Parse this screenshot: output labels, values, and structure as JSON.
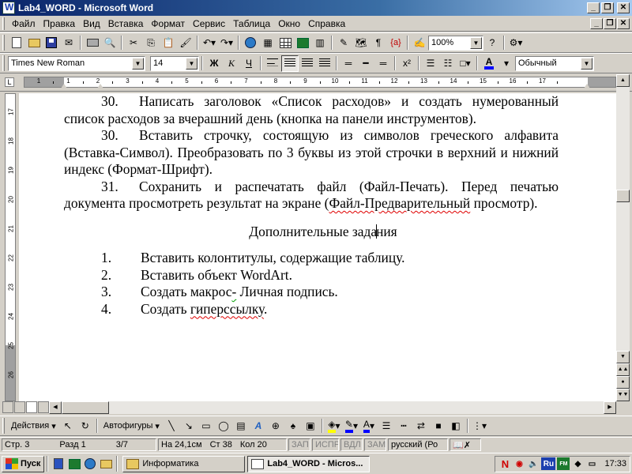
{
  "window": {
    "title": "Lab4_WORD - Microsoft Word"
  },
  "menu": [
    "Файл",
    "Правка",
    "Вид",
    "Вставка",
    "Формат",
    "Сервис",
    "Таблица",
    "Окно",
    "Справка"
  ],
  "standard_toolbar": {
    "zoom": "100%"
  },
  "formatting_toolbar": {
    "font": "Times New Roman",
    "size": "14",
    "bold": "Ж",
    "italic": "К",
    "underline": "Ч",
    "style": "Обычный",
    "superscript": "x²",
    "font_color": "A"
  },
  "ruler": {
    "h_numbers": [
      "1",
      "1",
      "2",
      "3",
      "4",
      "5",
      "6",
      "7",
      "8",
      "9",
      "10",
      "11",
      "12",
      "13",
      "14",
      "15",
      "16",
      "17"
    ],
    "v_numbers": [
      "17",
      "18",
      "19",
      "20",
      "21",
      "22",
      "23",
      "24",
      "25",
      "26",
      "27"
    ]
  },
  "document": {
    "p30a_num": "30.",
    "p30a_text": "Написать заголовок «Список расходов» и создать нумерованный список расходов за вчерашний день (кнопка на панели инструментов).",
    "p30b_num": "30.",
    "p30b_text": "Вставить строчку, состоящую из символов греческого алфавита (Вставка-Символ). Преобразовать по 3 буквы из этой строчки в верхний и нижний индекс (Формат-Шрифт).",
    "p31_num": "31.",
    "p31_text_a": "Сохранить и распечатать файл (Файл-Печать). Перед печатью документа просмотреть результат на экране (",
    "p31_text_b": "Файл-Предварительный",
    "p31_text_c": " просмотр).",
    "heading_a": "Дополнительные зада",
    "heading_b": "ния",
    "list": [
      {
        "num": "1.",
        "text": "Вставить колонтитулы, содержащие таблицу."
      },
      {
        "num": "2.",
        "text": "Вставить объект WordArt."
      },
      {
        "num": "3.",
        "text_a": "Создать макрос",
        "text_b": "-",
        "text_c": " Личная подпись."
      },
      {
        "num": "4.",
        "text_a": "Создать ",
        "text_b": "гиперссылку",
        "text_c": "."
      }
    ]
  },
  "drawing_toolbar": {
    "actions": "Действия",
    "autoshapes": "Автофигуры"
  },
  "status": {
    "page": "Стр. 3",
    "section": "Разд 1",
    "pages": "3/7",
    "at": "На 24,1см",
    "line": "Ст 38",
    "col": "Кол 20",
    "rec": "ЗАП",
    "trk": "ИСПР",
    "ext": "ВДЛ",
    "ovr": "ЗАМ",
    "lang": "русский (Ро"
  },
  "taskbar": {
    "start": "Пуск",
    "tasks": [
      {
        "label": "Информатика"
      },
      {
        "label": "Lab4_WORD - Micros..."
      }
    ],
    "tray_lang": "Ru",
    "clock": "17:33"
  },
  "colors": {
    "titlebar": "#0a246a",
    "spell_error": "#e00000",
    "highlight": "#ffff00",
    "font_color": "#0000ff"
  }
}
